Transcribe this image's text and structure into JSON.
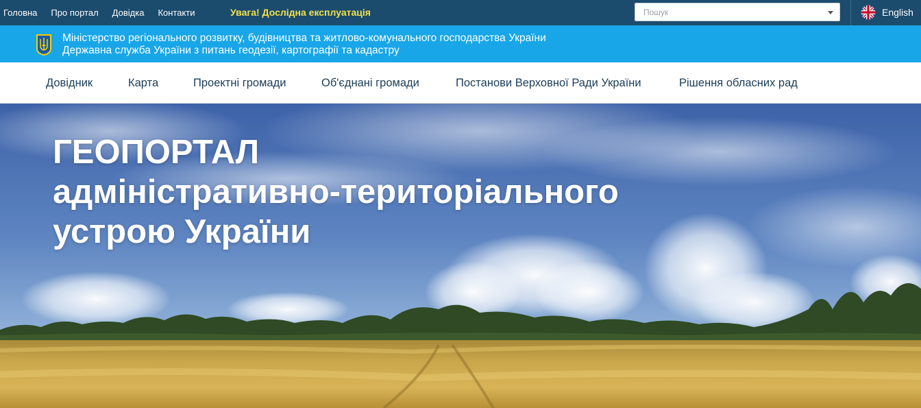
{
  "topbar": {
    "links": [
      {
        "label": "Головна"
      },
      {
        "label": "Про портал"
      },
      {
        "label": "Довідка"
      },
      {
        "label": "Контакти"
      }
    ],
    "notice": "Увага! Дослідна експлуатація",
    "search_placeholder": "Пошук",
    "language": "English",
    "language_icon": "uk-flag-icon",
    "colors": {
      "background": "#1b4b6d",
      "notice": "#f2e14b"
    }
  },
  "ministry": {
    "emblem_icon": "trident-icon",
    "line1": "Міністерство регіонального розвитку, будівництва та житлово-комунального господарства України",
    "line2": "Державна служба України з питань геодезії, картографії та кадастру",
    "color": "#18a6e8"
  },
  "nav": {
    "items": [
      {
        "label": "Довідник"
      },
      {
        "label": "Карта"
      },
      {
        "label": "Проектні громади"
      },
      {
        "label": "Об'єднані громади"
      },
      {
        "label": "Постанови Верховної Ради України"
      },
      {
        "label": "Рішення обласних рад"
      }
    ]
  },
  "hero": {
    "title_line1": "ГЕОПОРТАЛ",
    "title_line2": "адміністративно-територіального",
    "title_line3": "устрою України"
  }
}
